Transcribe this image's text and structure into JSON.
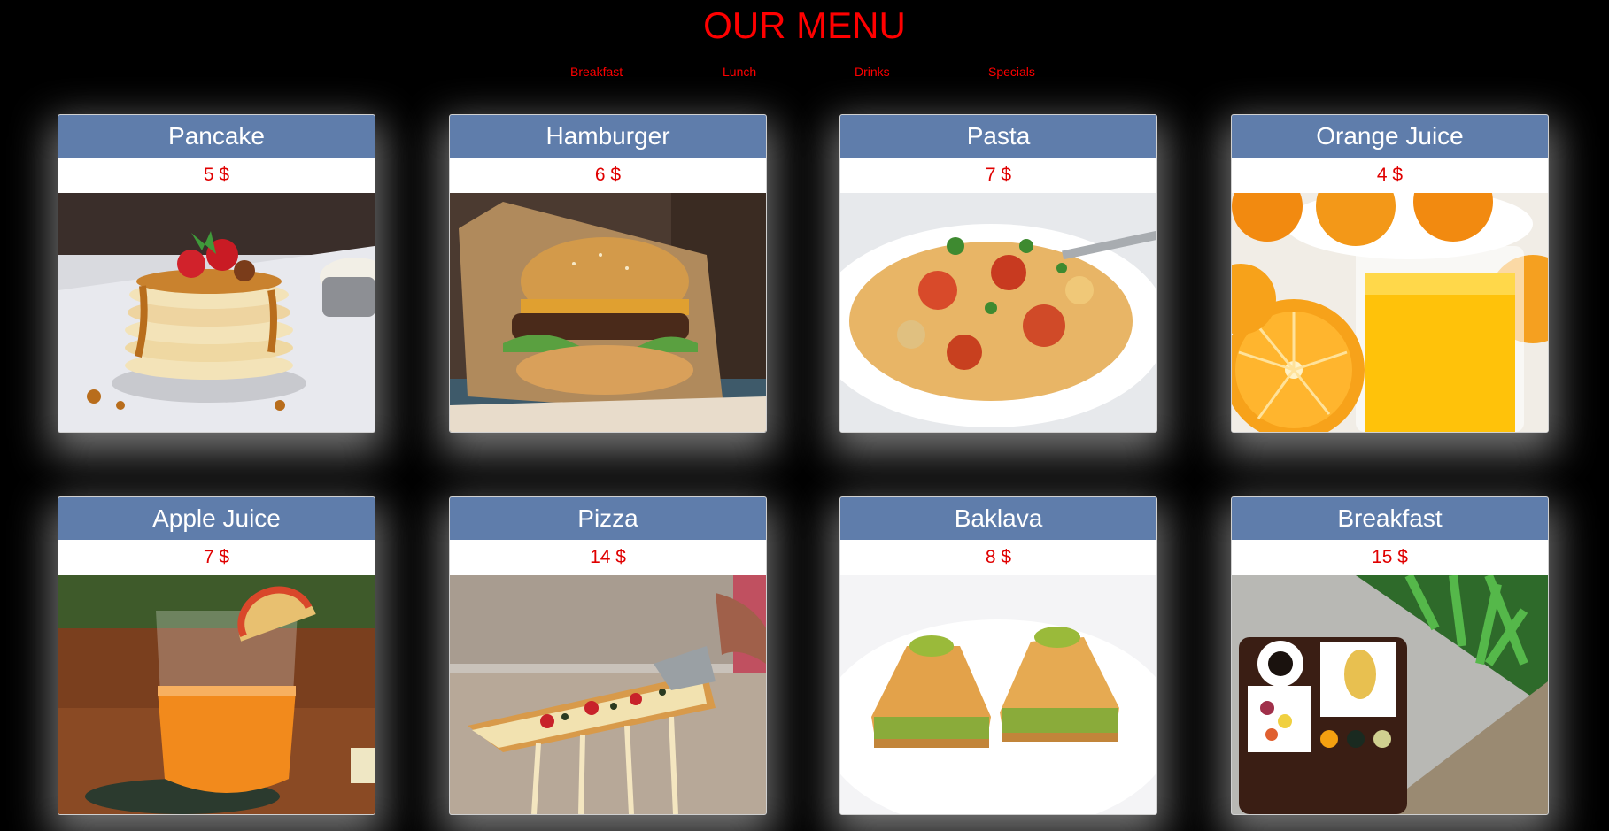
{
  "page": {
    "title": "OUR MENU",
    "accent_color": "#ff0000",
    "card_header_color": "#5f7dab",
    "price_color": "#e00000"
  },
  "nav": {
    "items": [
      {
        "label": "Breakfast"
      },
      {
        "label": "Lunch"
      },
      {
        "label": "Drinks"
      },
      {
        "label": "Specials"
      }
    ]
  },
  "menu": {
    "items": [
      {
        "name": "Pancake",
        "price": "5 $",
        "image": "pancake-stack-photo"
      },
      {
        "name": "Hamburger",
        "price": "6 $",
        "image": "hamburger-photo"
      },
      {
        "name": "Pasta",
        "price": "7 $",
        "image": "pasta-bowl-photo"
      },
      {
        "name": "Orange Juice",
        "price": "4 $",
        "image": "orange-juice-photo"
      },
      {
        "name": "Apple Juice",
        "price": "7 $",
        "image": "apple-juice-photo"
      },
      {
        "name": "Pizza",
        "price": "14 $",
        "image": "pizza-slice-photo"
      },
      {
        "name": "Baklava",
        "price": "8 $",
        "image": "baklava-photo"
      },
      {
        "name": "Breakfast",
        "price": "15 $",
        "image": "breakfast-tray-photo"
      }
    ]
  }
}
